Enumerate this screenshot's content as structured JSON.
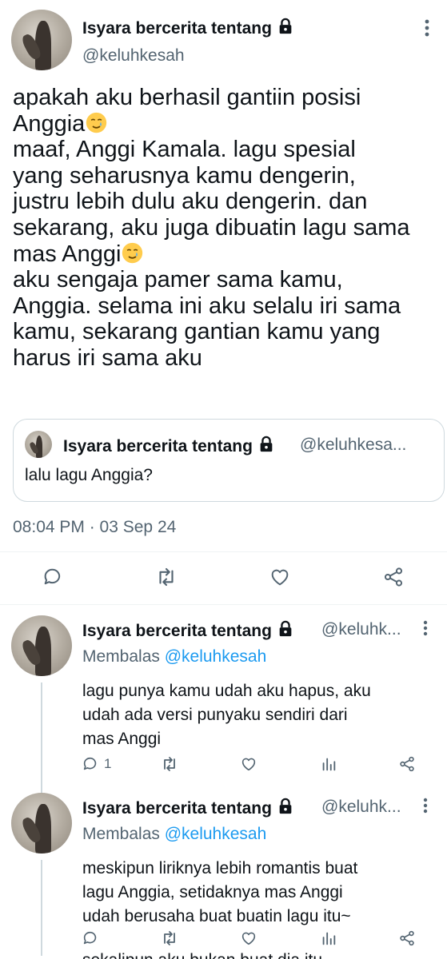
{
  "main_tweet": {
    "display_name": "Isyara bercerita tentang",
    "handle": "@keluhkesah",
    "text_lines": [
      "apakah aku berhasil gantiin posisi",
      "Anggia",
      "maaf, Anggi Kamala. lagu spesial",
      "yang seharusnya kamu dengerin,",
      "justru lebih dulu aku dengerin. dan",
      "sekarang, aku juga dibuatin lagu sama",
      "mas Anggi",
      "aku sengaja pamer sama kamu,",
      "Anggia. selama ini aku selalu iri sama",
      "kamu, sekarang gantian kamu yang",
      "harus iri sama aku"
    ],
    "emoji": "smiling-face-with-tear",
    "timestamp": "08:04 PM · 03 Sep 24",
    "actions": [
      "reply-icon",
      "retweet-icon",
      "like-icon",
      "share-icon"
    ]
  },
  "quoted_tweet": {
    "display_name": "Isyara bercerita tentang",
    "handle": "@keluhkesa...",
    "text": "lalu lagu Anggia?"
  },
  "replies": [
    {
      "display_name": "Isyara bercerita tentang",
      "handle": "@keluhk...",
      "replying_prefix": "Membalas",
      "replying_to": "@keluhkesah",
      "text_lines": [
        "lagu punya kamu udah aku hapus, aku",
        "udah ada versi punyaku sendiri dari",
        "mas Anggi"
      ],
      "reply_count": "1"
    },
    {
      "display_name": "Isyara bercerita tentang",
      "handle": "@keluhk...",
      "replying_prefix": "Membalas",
      "replying_to": "@keluhkesah",
      "text_lines": [
        "meskipun liriknya lebih romantis buat",
        "lagu Anggia, setidaknya mas Anggi",
        "udah berusaha buat buatin lagu itu~"
      ],
      "reply_count": ""
    }
  ],
  "cut_off_text": "sekalipun aku bukan buat dia itu",
  "colors": {
    "text": "#0f1419",
    "secondary": "#536471",
    "link": "#1d9bf0",
    "border": "#cfd9de"
  }
}
